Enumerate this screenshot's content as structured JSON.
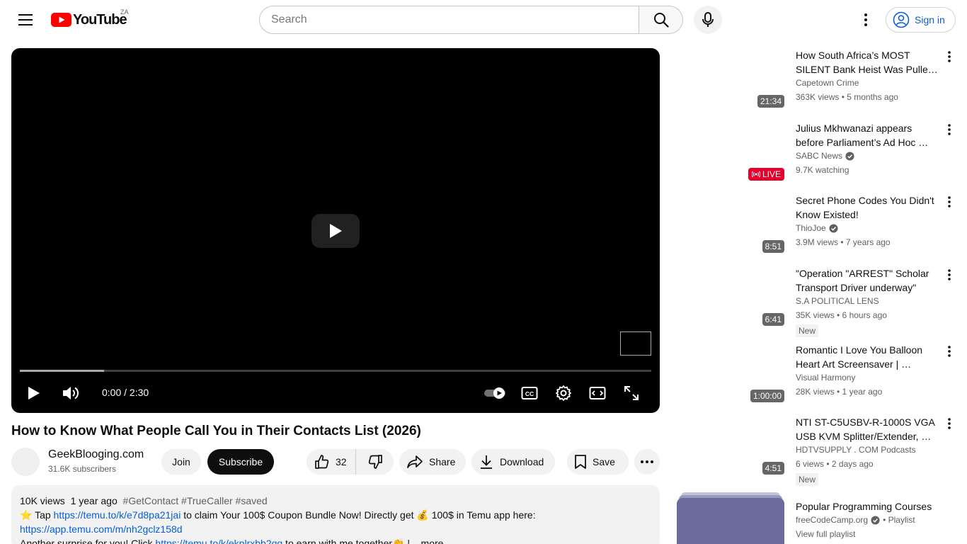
{
  "masthead": {
    "logo_text": "YouTube",
    "country_code": "ZA",
    "search_placeholder": "Search",
    "signin_label": "Sign in"
  },
  "player": {
    "time": "0:00 / 2:30",
    "progress_fraction": 0.133
  },
  "video": {
    "title": "How to Know What People Call You in Their Contacts List (2026)",
    "channel": "GeekBlooging.com",
    "subscribers": "31.6K subscribers",
    "join_label": "Join",
    "subscribe_label": "Subscribe",
    "like_count": "32",
    "share_label": "Share",
    "download_label": "Download",
    "save_label": "Save"
  },
  "description": {
    "views": "10K views",
    "age": "1 year ago",
    "tags": "#GetContact #TrueCaller #saved",
    "line1_pre": "⭐ Tap ",
    "link1": "https://temu.to/k/e7d8pa21jai",
    "line1_post": " to claim Your 100$ Coupon Bundle Now! Directly get 💰 100$ in Temu app here:",
    "link2": "https://app.temu.com/m/nh2gclz158d",
    "line3_pre": "Another surprise for you! Click ",
    "link3": "https://temu.to/k/ekplrxbb2qq",
    "line3_post": " to earn with me together👏 | ",
    "more_label": "...more"
  },
  "recommendations": [
    {
      "title1": "How South Africa’s MOST",
      "title2": "SILENT Bank Heist Was Pulle…",
      "channel": "Capetown Crime",
      "verified": false,
      "meta": "363K views • 5 months ago",
      "badge": "21:34",
      "live": false,
      "new": ""
    },
    {
      "title1": "Julius Mkhwanazi appears",
      "title2": "before Parliament’s Ad Hoc …",
      "channel": "SABC News",
      "verified": true,
      "meta": "9.7K watching",
      "badge": "LIVE",
      "live": true,
      "new": ""
    },
    {
      "title1": "Secret Phone Codes You Didn't",
      "title2": "Know Existed!",
      "channel": "ThioJoe",
      "verified": true,
      "meta": "3.9M views • 7 years ago",
      "badge": "8:51",
      "live": false,
      "new": ""
    },
    {
      "title1": "\"Operation \"ARREST\" Scholar",
      "title2": "Transport Driver underway\"",
      "channel": "S.A POLITICAL LENS",
      "verified": false,
      "meta": "35K views • 6 hours ago",
      "badge": "6:41",
      "live": false,
      "new": "New"
    },
    {
      "title1": "Romantic I Love You Balloon",
      "title2": "Heart Art Screensaver | …",
      "channel": "Visual Harmony",
      "verified": false,
      "meta": "28K views • 1 year ago",
      "badge": "1:00:00",
      "live": false,
      "new": ""
    },
    {
      "title1": "NTI ST-C5USBV-R-1000S VGA",
      "title2": "USB KVM Splitter/Extender, …",
      "channel": "HDTVSUPPLY . COM Podcasts",
      "verified": false,
      "meta": "6 views • 2 days ago",
      "badge": "4:51",
      "live": false,
      "new": "New"
    }
  ],
  "playlist": {
    "title": "Popular Programming Courses",
    "channel": "freeCodeCamp.org",
    "kind": "• Playlist",
    "link": "View full playlist"
  }
}
